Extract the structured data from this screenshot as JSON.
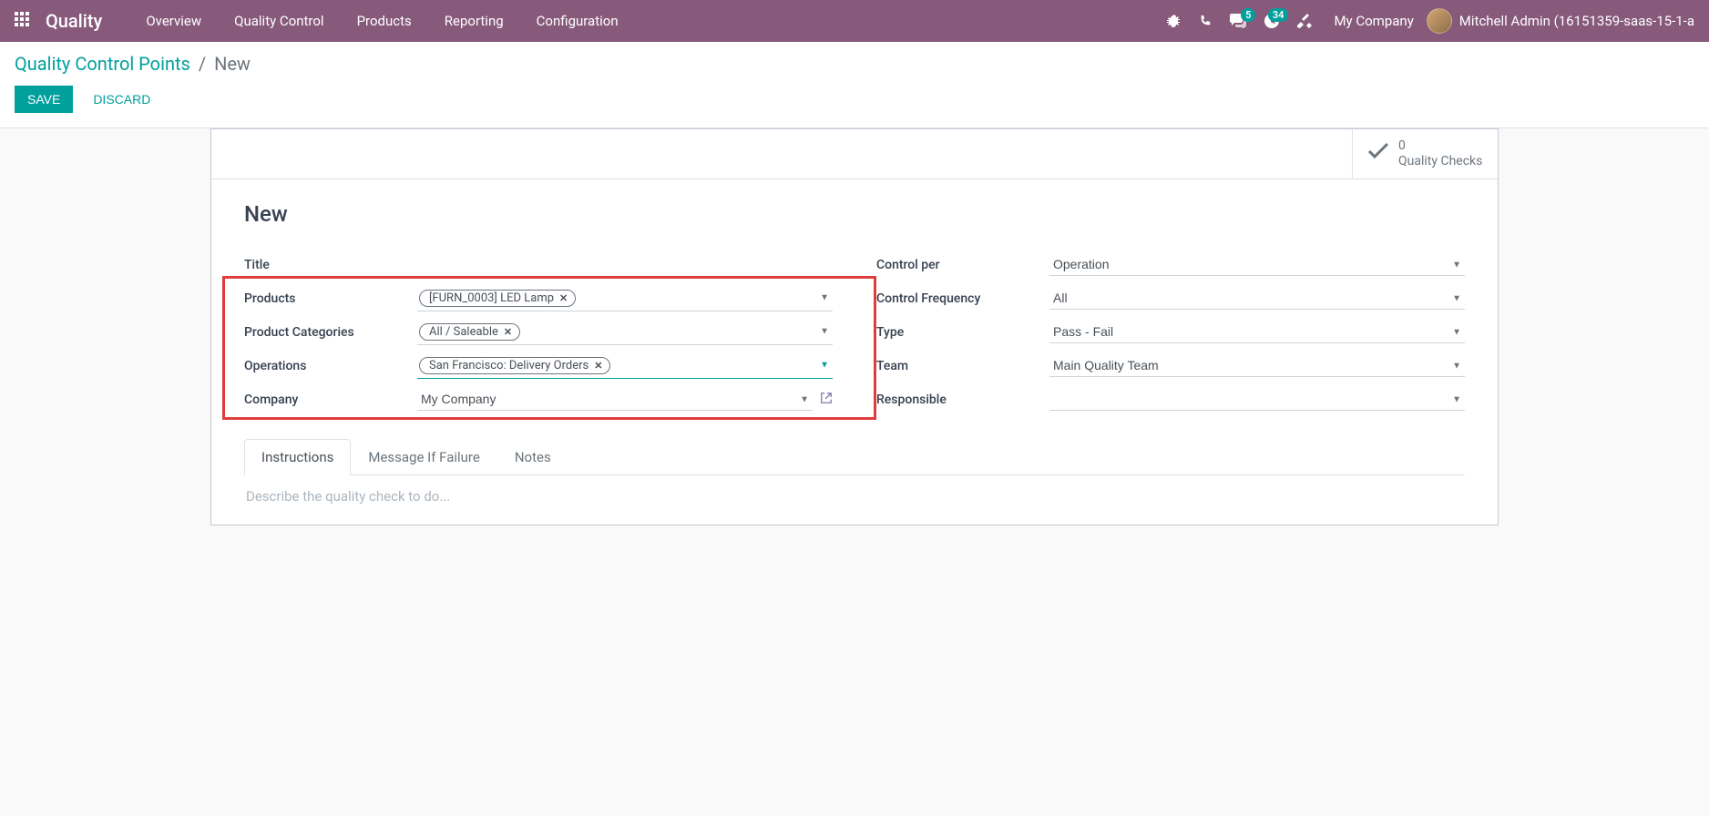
{
  "navbar": {
    "app_name": "Quality",
    "menu": [
      "Overview",
      "Quality Control",
      "Products",
      "Reporting",
      "Configuration"
    ],
    "messages_badge": "5",
    "activities_badge": "34",
    "company": "My Company",
    "user": "Mitchell Admin (16151359-saas-15-1-a"
  },
  "breadcrumb": {
    "parent": "Quality Control Points",
    "current": "New"
  },
  "buttons": {
    "save": "Save",
    "discard": "Discard"
  },
  "stat_button": {
    "count": "0",
    "label": "Quality Checks"
  },
  "form": {
    "title": "New",
    "left": {
      "title_label": "Title",
      "products_label": "Products",
      "products_tag": "[FURN_0003] LED Lamp",
      "categories_label": "Product Categories",
      "categories_tag": "All / Saleable",
      "operations_label": "Operations",
      "operations_tag": "San Francisco: Delivery Orders",
      "company_label": "Company",
      "company_value": "My Company"
    },
    "right": {
      "control_per_label": "Control per",
      "control_per_value": "Operation",
      "control_freq_label": "Control Frequency",
      "control_freq_value": "All",
      "type_label": "Type",
      "type_value": "Pass - Fail",
      "team_label": "Team",
      "team_value": "Main Quality Team",
      "responsible_label": "Responsible",
      "responsible_value": ""
    }
  },
  "tabs": {
    "instructions": "Instructions",
    "message_if_failure": "Message If Failure",
    "notes": "Notes",
    "placeholder": "Describe the quality check to do..."
  }
}
